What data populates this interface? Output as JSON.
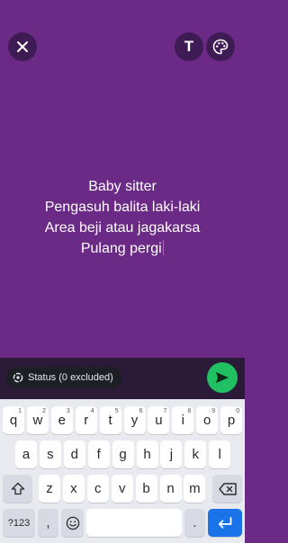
{
  "canvas": {
    "background_color": "#6b2a85",
    "close_icon": "close-icon",
    "text_tool_label": "T",
    "palette_icon": "palette-icon",
    "text_lines": [
      "Baby sitter",
      "Pengasuh balita laki-laki",
      "Area beji atau jagakarsa",
      "Pulang pergi"
    ]
  },
  "footer": {
    "status_chip_label": "Status (0 excluded)",
    "status_chip_icon": "status-ring-icon",
    "send_icon": "send-icon",
    "send_color": "#21c063"
  },
  "keyboard": {
    "row1": [
      {
        "k": "q",
        "n": "1"
      },
      {
        "k": "w",
        "n": "2"
      },
      {
        "k": "e",
        "n": "3"
      },
      {
        "k": "r",
        "n": "4"
      },
      {
        "k": "t",
        "n": "5"
      },
      {
        "k": "y",
        "n": "6"
      },
      {
        "k": "u",
        "n": "7"
      },
      {
        "k": "i",
        "n": "8"
      },
      {
        "k": "o",
        "n": "9"
      },
      {
        "k": "p",
        "n": "0"
      }
    ],
    "row2": [
      "a",
      "s",
      "d",
      "f",
      "g",
      "h",
      "j",
      "k",
      "l"
    ],
    "row3": [
      "z",
      "x",
      "c",
      "v",
      "b",
      "n",
      "m"
    ],
    "symbols_label": "?123",
    "comma_label": ",",
    "period_label": ".",
    "shift_icon": "shift-icon",
    "backspace_icon": "backspace-icon",
    "emoji_icon": "emoji-icon",
    "enter_icon": "enter-icon"
  }
}
